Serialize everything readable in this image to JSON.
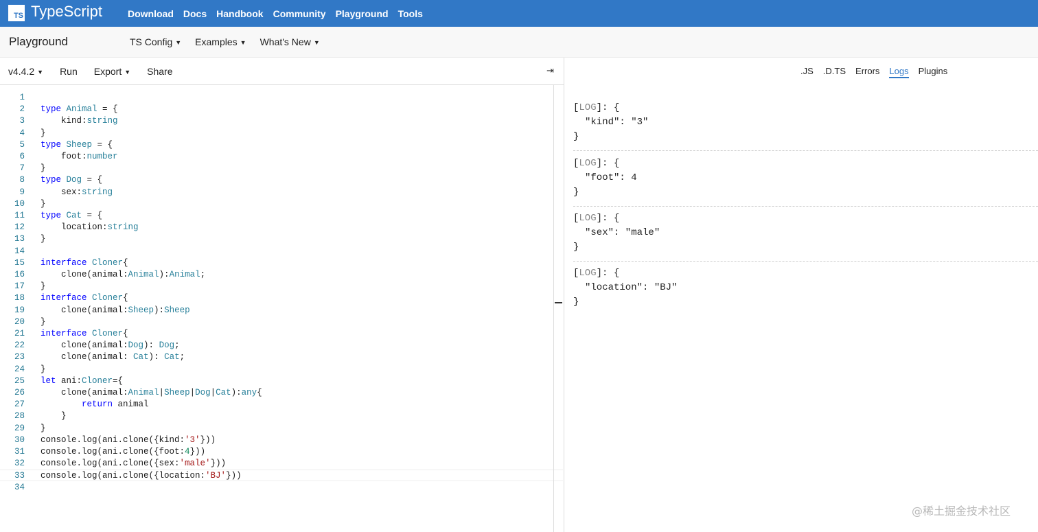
{
  "nav": {
    "logo_badge": "TS",
    "logo_text": "TypeScript",
    "links": [
      "Download",
      "Docs",
      "Handbook",
      "Community",
      "Playground",
      "Tools"
    ],
    "bg_color": "#3178c6"
  },
  "subbar": {
    "title": "Playground",
    "menus": [
      "TS Config",
      "Examples",
      "What's New"
    ]
  },
  "toolbar": {
    "version": "v4.4.2",
    "run": "Run",
    "export": "Export",
    "share": "Share",
    "collapse_icon": "⇥"
  },
  "editor": {
    "line_numbers": [
      "1",
      "2",
      "3",
      "4",
      "5",
      "6",
      "7",
      "8",
      "9",
      "10",
      "11",
      "12",
      "13",
      "14",
      "15",
      "16",
      "17",
      "18",
      "19",
      "20",
      "21",
      "22",
      "23",
      "24",
      "25",
      "26",
      "27",
      "28",
      "29",
      "30",
      "31",
      "32",
      "33",
      "34"
    ],
    "lines": [
      "",
      "type Animal = {",
      "    kind:string",
      "}",
      "type Sheep = {",
      "    foot:number",
      "}",
      "type Dog = {",
      "    sex:string",
      "}",
      "type Cat = {",
      "    location:string",
      "}",
      "",
      "interface Cloner{",
      "    clone(animal:Animal):Animal;",
      "}",
      "interface Cloner{",
      "    clone(animal:Sheep):Sheep",
      "}",
      "interface Cloner{",
      "    clone(animal:Dog): Dog;",
      "    clone(animal: Cat): Cat;",
      "}",
      "let ani:Cloner={",
      "    clone(animal:Animal|Sheep|Dog|Cat):any{",
      "        return animal",
      "    }",
      "}",
      "console.log(ani.clone({kind:'3'}))",
      "console.log(ani.clone({foot:4}))",
      "console.log(ani.clone({sex:'male'}))",
      "console.log(ani.clone({location:'BJ'}))",
      ""
    ],
    "active_line": 33
  },
  "output": {
    "tabs": [
      ".JS",
      ".D.TS",
      "Errors",
      "Logs",
      "Plugins"
    ],
    "active_tab": "Logs",
    "logs": [
      {
        "open_a": "[",
        "level": "LOG",
        "open_b": "]: {",
        "body": "\"kind\": \"3\"",
        "close": "}"
      },
      {
        "open_a": "[",
        "level": "LOG",
        "open_b": "]: {",
        "body": "\"foot\": 4",
        "close": "}"
      },
      {
        "open_a": "[",
        "level": "LOG",
        "open_b": "]: {",
        "body": "\"sex\": \"male\"",
        "close": "}"
      },
      {
        "open_a": "[",
        "level": "LOG",
        "open_b": "]: {",
        "body": "\"location\": \"BJ\"",
        "close": "}"
      }
    ]
  },
  "watermark": "@稀土掘金技术社区"
}
